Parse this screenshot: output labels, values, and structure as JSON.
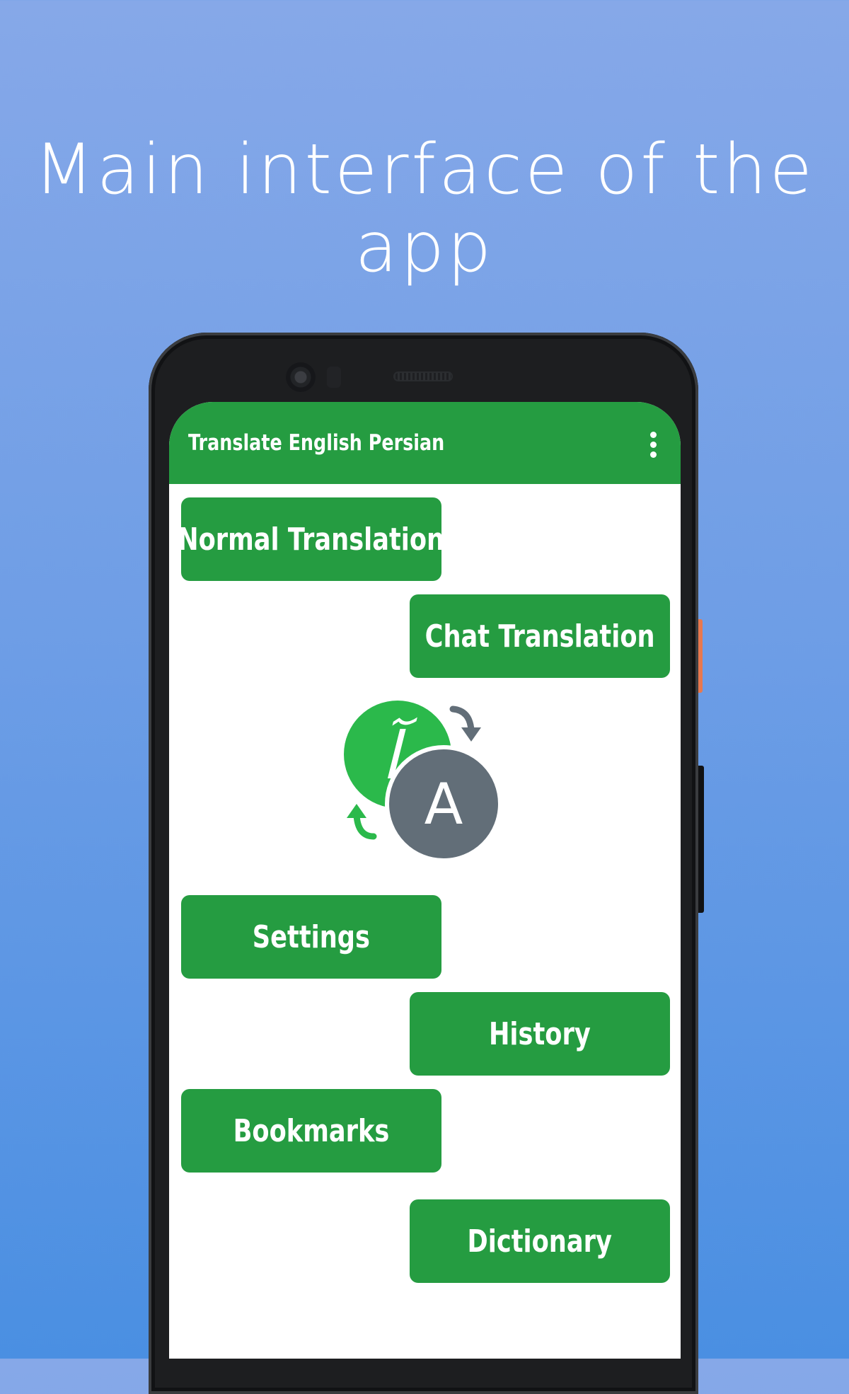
{
  "headline": "Main interface of the app",
  "app": {
    "title": "Translate English Persian",
    "menu_icon": "more-vert-icon",
    "logo": {
      "persian_letter": "آ",
      "latin_letter": "A",
      "icon": "translate-swap-icon"
    },
    "buttons": {
      "normal_translation": "Normal Translation",
      "chat_translation": "Chat Translation",
      "settings": "Settings",
      "history": "History",
      "bookmarks": "Bookmarks",
      "dictionary": "Dictionary"
    }
  },
  "colors": {
    "background_top": "#86a8e8",
    "background_bottom": "#4a8fe2",
    "primary_green": "#259c41",
    "logo_green": "#2bb94b",
    "logo_grey": "#626e78",
    "phone_frame": "#1d1e20",
    "accent_side_button": "#e8784e"
  }
}
